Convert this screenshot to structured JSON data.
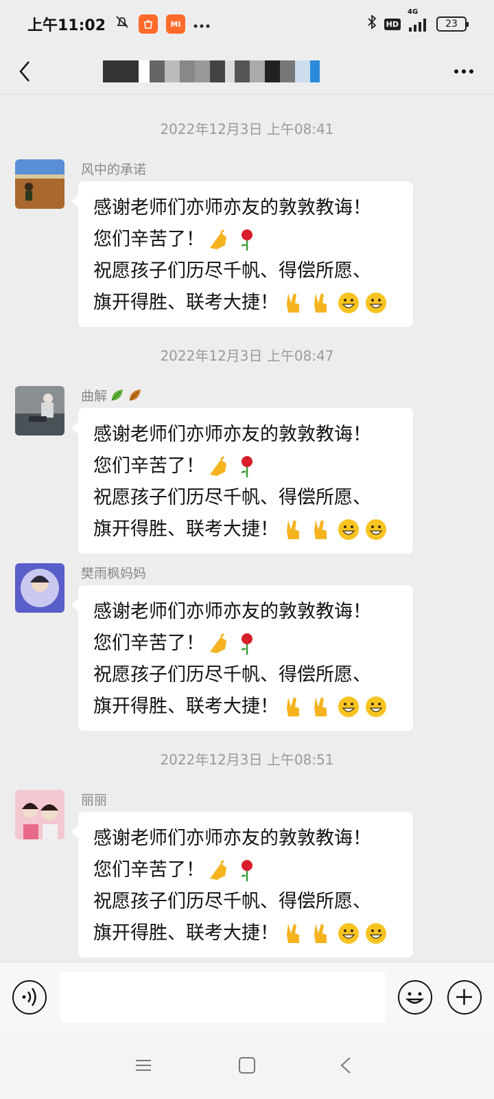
{
  "status_bar": {
    "time": "上午11:02",
    "mi_label": "MI",
    "network": "4G",
    "battery": "23"
  },
  "header": {
    "title_redacted": true
  },
  "chat": {
    "messages": [
      {
        "timestamp": "2022年12月3日 上午08:41",
        "sender": "风中的承诺",
        "sender_icons": [],
        "lines": [
          "感谢老师们亦师亦友的敦敦教诲！",
          "您们辛苦了！",
          "祝愿孩子们历尽千帆、得偿所愿、",
          "旗开得胜、联考大捷！"
        ],
        "line2_emojis": [
          "clap-hand-emoji",
          "rose-emoji"
        ],
        "line4_emojis": [
          "victory-hand-emoji",
          "victory-hand-emoji",
          "grin-emoji",
          "grin-emoji"
        ]
      },
      {
        "timestamp": "2022年12月3日 上午08:47",
        "sender": "曲解",
        "sender_icons": [
          "leaf-icon",
          "fallen-leaf-icon"
        ],
        "lines": [
          "感谢老师们亦师亦友的敦敦教诲！",
          "您们辛苦了！",
          "祝愿孩子们历尽千帆、得偿所愿、",
          "旗开得胜、联考大捷！"
        ],
        "line2_emojis": [
          "clap-hand-emoji",
          "rose-emoji"
        ],
        "line4_emojis": [
          "victory-hand-emoji",
          "victory-hand-emoji",
          "grin-emoji",
          "grin-emoji"
        ]
      },
      {
        "timestamp": "",
        "sender": "樊雨枫妈妈",
        "sender_icons": [],
        "lines": [
          "感谢老师们亦师亦友的敦敦教诲！",
          "您们辛苦了！",
          "祝愿孩子们历尽千帆、得偿所愿、",
          "旗开得胜、联考大捷！"
        ],
        "line2_emojis": [
          "clap-hand-emoji",
          "rose-emoji"
        ],
        "line4_emojis": [
          "victory-hand-emoji",
          "victory-hand-emoji",
          "grin-emoji",
          "grin-emoji"
        ]
      },
      {
        "timestamp": "2022年12月3日 上午08:51",
        "sender": "丽丽",
        "sender_icons": [],
        "lines": [
          "感谢老师们亦师亦友的敦敦教诲！",
          "您们辛苦了！",
          "祝愿孩子们历尽千帆、得偿所愿、",
          "旗开得胜、联考大捷！"
        ],
        "line2_emojis": [
          "clap-hand-emoji",
          "rose-emoji"
        ],
        "line4_emojis": [
          "victory-hand-emoji",
          "victory-hand-emoji",
          "grin-emoji",
          "grin-emoji"
        ]
      }
    ]
  },
  "input_bar": {
    "text_value": "",
    "icons": [
      "voice-icon",
      "emoji-icon",
      "plus-icon"
    ]
  },
  "nav_bar": {
    "icons": [
      "menu-icon",
      "home-icon",
      "back-icon"
    ]
  },
  "colors": {
    "background": "#ededed",
    "bubble": "#ffffff",
    "timestamp_text": "#9a9a9a",
    "sender_text": "#888888"
  }
}
